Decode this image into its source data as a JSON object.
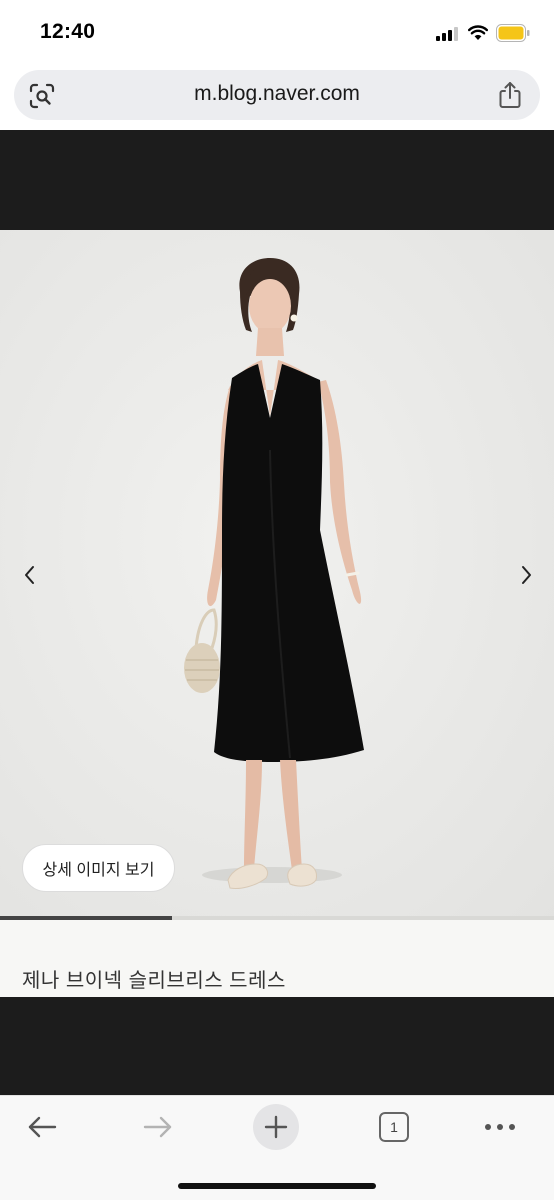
{
  "status_bar": {
    "time": "12:40",
    "icons": [
      "signal-icon",
      "wifi-icon",
      "battery-icon"
    ],
    "battery_color": "#f5c518"
  },
  "browser": {
    "url": "m.blog.naver.com",
    "left_icon": "lens-icon",
    "right_icon": "share-icon"
  },
  "gallery": {
    "detail_button_label": "상세 이미지 보기",
    "prev_icon": "chevron-left-icon",
    "next_icon": "chevron-right-icon",
    "progress_fraction": 0.31,
    "caption": "제나 브이넥 슬리브리스 드레스"
  },
  "toolbar": {
    "back_icon": "arrow-left-icon",
    "forward_icon": "arrow-right-icon",
    "new_tab_icon": "plus-icon",
    "tab_count": "1",
    "menu_icon": "more-icon"
  },
  "colors": {
    "dark_band": "#1c1c1c",
    "url_pill": "#ecedf0",
    "photo_background": "#e9e9e7",
    "dress": "#0d0d0d"
  }
}
